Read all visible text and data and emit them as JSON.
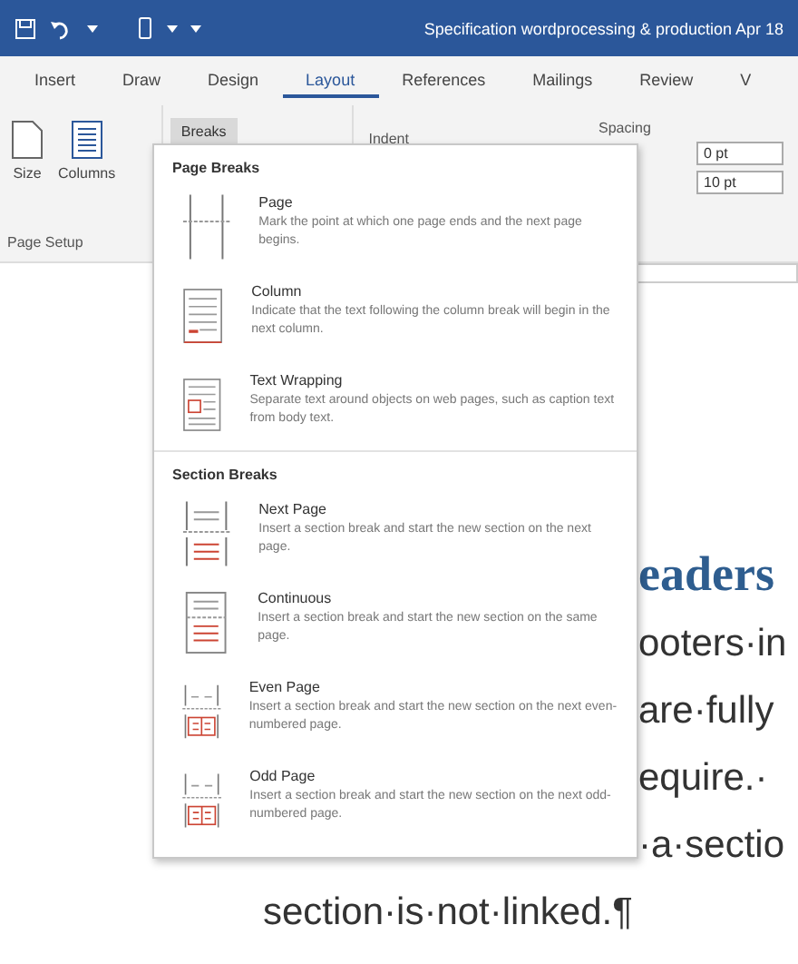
{
  "title_bar": {
    "title": "Specification wordprocessing & production Apr 18"
  },
  "tabs": [
    {
      "label": "Insert",
      "selected": false
    },
    {
      "label": "Draw",
      "selected": false
    },
    {
      "label": "Design",
      "selected": false
    },
    {
      "label": "Layout",
      "selected": true
    },
    {
      "label": "References",
      "selected": false
    },
    {
      "label": "Mailings",
      "selected": false
    },
    {
      "label": "Review",
      "selected": false
    },
    {
      "label": "V",
      "selected": false
    }
  ],
  "ribbon": {
    "size": "Size",
    "columns": "Columns",
    "breaks": "Breaks",
    "indent": "Indent",
    "spacing": "Spacing",
    "spacing_before": "0 pt",
    "spacing_after": "10 pt",
    "group": "Page Setup"
  },
  "breaks_menu": {
    "sections": [
      {
        "heading": "Page Breaks",
        "items": [
          {
            "kind": "page",
            "title": "Page",
            "description": "Mark the point at which one page ends and the next page begins."
          },
          {
            "kind": "column",
            "title": "Column",
            "description": "Indicate that the text following the column break will begin in the next column."
          },
          {
            "kind": "wrap",
            "title": "Text Wrapping",
            "description": "Separate text around objects on web pages, such as caption text from body text."
          }
        ]
      },
      {
        "heading": "Section Breaks",
        "items": [
          {
            "kind": "next",
            "title": "Next Page",
            "description": "Insert a section break and start the new section on the next page."
          },
          {
            "kind": "continuous",
            "title": "Continuous",
            "description": "Insert a section break and start the new section on the same page."
          },
          {
            "kind": "even",
            "title": "Even Page",
            "description": "Insert a section break and start the new section on the next even-numbered page."
          },
          {
            "kind": "odd",
            "title": "Odd Page",
            "description": "Insert a section break and start the new section on the next odd-numbered page."
          }
        ]
      }
    ]
  },
  "document": {
    "heading": "eaders",
    "lines": [
      "ooters·in",
      "are·fully",
      "equire.·",
      "·a·sectio"
    ],
    "last_line": "section·is·not·linked.¶"
  }
}
